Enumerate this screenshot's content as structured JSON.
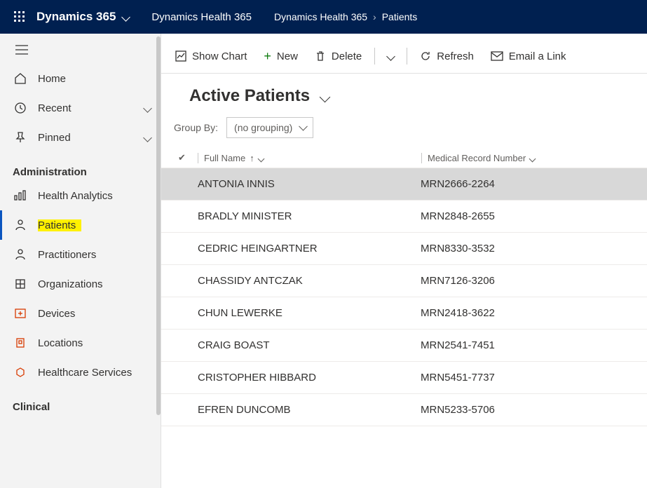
{
  "topbar": {
    "brand": "Dynamics 365",
    "app_name": "Dynamics Health 365",
    "breadcrumb_root": "Dynamics Health 365",
    "breadcrumb_current": "Patients"
  },
  "sidebar": {
    "quick": {
      "home": "Home",
      "recent": "Recent",
      "pinned": "Pinned"
    },
    "sections": {
      "administration": {
        "title": "Administration",
        "items": [
          {
            "label": "Health Analytics"
          },
          {
            "label": "Patients",
            "active": true
          },
          {
            "label": "Practitioners"
          },
          {
            "label": "Organizations"
          },
          {
            "label": "Devices"
          },
          {
            "label": "Locations"
          },
          {
            "label": "Healthcare Services"
          }
        ]
      },
      "clinical": {
        "title": "Clinical"
      }
    }
  },
  "commandbar": {
    "show_chart": "Show Chart",
    "new": "New",
    "delete": "Delete",
    "refresh": "Refresh",
    "email_link": "Email a Link"
  },
  "view": {
    "title": "Active Patients",
    "groupby_label": "Group By:",
    "groupby_value": "(no grouping)"
  },
  "grid": {
    "columns": {
      "full_name": "Full Name",
      "mrn": "Medical Record Number"
    },
    "rows": [
      {
        "full_name": "ANTONIA INNIS",
        "mrn": "MRN2666-2264",
        "selected": true
      },
      {
        "full_name": "BRADLY MINISTER",
        "mrn": "MRN2848-2655"
      },
      {
        "full_name": "CEDRIC HEINGARTNER",
        "mrn": "MRN8330-3532"
      },
      {
        "full_name": "CHASSIDY ANTCZAK",
        "mrn": "MRN7126-3206"
      },
      {
        "full_name": "CHUN LEWERKE",
        "mrn": "MRN2418-3622"
      },
      {
        "full_name": "CRAIG BOAST",
        "mrn": "MRN2541-7451"
      },
      {
        "full_name": "CRISTOPHER HIBBARD",
        "mrn": "MRN5451-7737"
      },
      {
        "full_name": "EFREN DUNCOMB",
        "mrn": "MRN5233-5706"
      }
    ]
  }
}
